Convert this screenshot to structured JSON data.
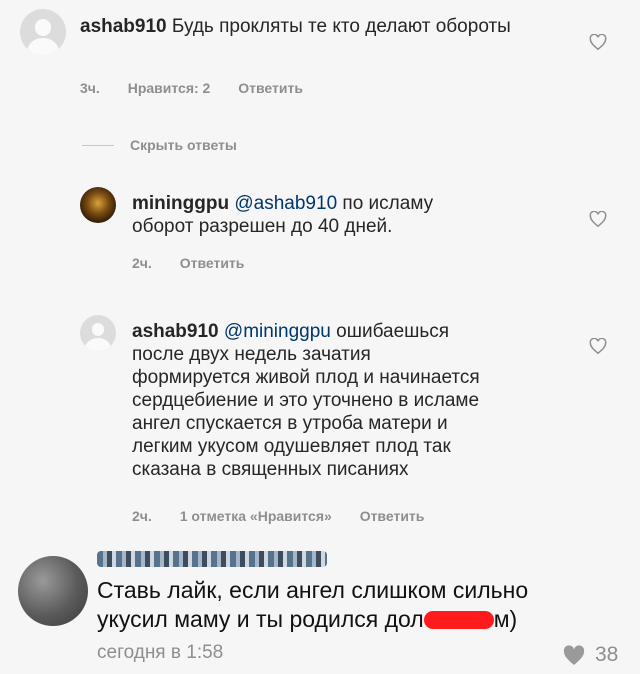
{
  "comment1": {
    "username": "ashab910",
    "text": "Будь прокляты те кто делают обороты",
    "time": "3ч.",
    "likes": "Нравится: 2",
    "reply": "Ответить"
  },
  "hide_replies": "Скрыть ответы",
  "reply1": {
    "username": "mininggpu",
    "mention": "@ashab910",
    "text_line1": "по исламу",
    "text_line2": "оборот разрешен до 40 дней.",
    "time": "2ч.",
    "reply": "Ответить"
  },
  "reply2": {
    "username": "ashab910",
    "mention": "@mininggpu",
    "text_line1": "ошибаешься",
    "lines": [
      "после двух недель зачатия",
      "формируется живой плод и начинается",
      "сердцебиение и это уточнено в исламе",
      "ангел спускается в утроба матери и",
      "легким укусом одушевляет плод так",
      "сказана в священных писаниях"
    ],
    "time": "2ч.",
    "likes": "1 отметка «Нравится»",
    "reply": "Ответить"
  },
  "comment2": {
    "line1": "Ставь лайк, если ангел слишком сильно",
    "line2_start": "укусил маму и ты родился дол",
    "line2_end": "м)",
    "time": "сегодня в 1:58",
    "like_count": "38"
  },
  "icons": {
    "heart": "heart-outline-icon",
    "heart_filled": "heart-filled-icon",
    "avatar_default": "default-avatar-icon"
  },
  "colors": {
    "redaction": "#ff1b1b",
    "mention": "#00376b"
  }
}
